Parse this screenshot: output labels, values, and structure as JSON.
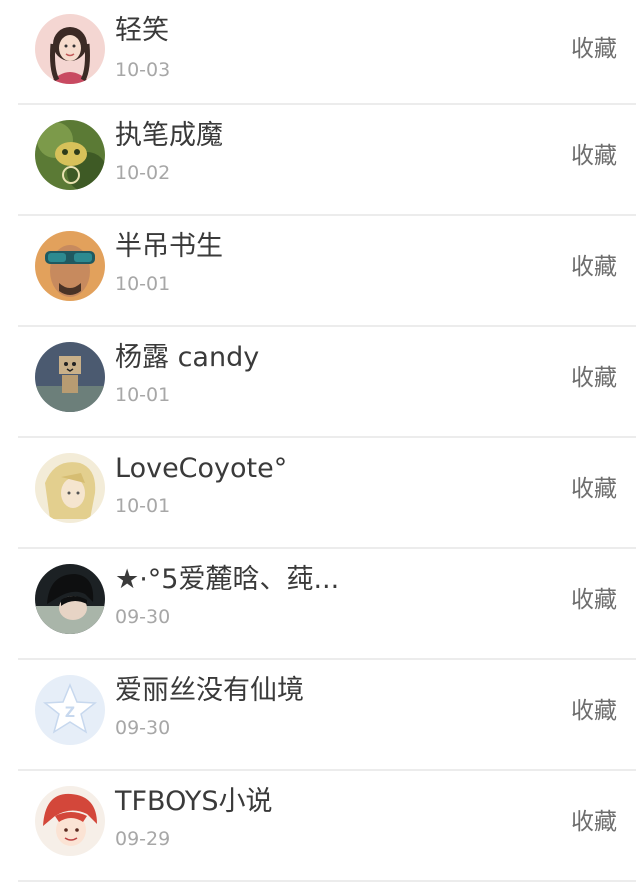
{
  "items": [
    {
      "name": "轻笑",
      "date": "10-03",
      "action": "收藏",
      "avatar": "avatar-portrait-woman"
    },
    {
      "name": "执笔成魔",
      "date": "10-02",
      "action": "收藏",
      "avatar": "avatar-green-cat"
    },
    {
      "name": "半吊书生",
      "date": "10-01",
      "action": "收藏",
      "avatar": "avatar-man-goggles"
    },
    {
      "name": "杨露 candy",
      "date": "10-01",
      "action": "收藏",
      "avatar": "avatar-danbo-box"
    },
    {
      "name": "LoveCoyote°",
      "date": "10-01",
      "action": "收藏",
      "avatar": "avatar-anime-blonde"
    },
    {
      "name": "★·°5爱麓晗、莼...",
      "date": "09-30",
      "action": "收藏",
      "avatar": "avatar-dark-hair"
    },
    {
      "name": "爱丽丝没有仙境",
      "date": "09-30",
      "action": "收藏",
      "avatar": "avatar-qzone-star"
    },
    {
      "name": "TFBOYS小说",
      "date": "09-29",
      "action": "收藏",
      "avatar": "avatar-anime-redhead"
    }
  ]
}
